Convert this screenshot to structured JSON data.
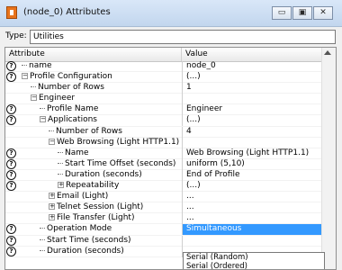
{
  "window": {
    "title": "(node_0) Attributes",
    "buttons": [
      "▭",
      "▣",
      "✕"
    ]
  },
  "type": {
    "label": "Type:",
    "value": "Utilities"
  },
  "headers": {
    "attribute": "Attribute",
    "value": "Value"
  },
  "rows": [
    {
      "q": true,
      "indent": 0,
      "prefix": "dash",
      "label": "name",
      "value": "node_0"
    },
    {
      "q": true,
      "indent": 0,
      "prefix": "minus",
      "label": "Profile Configuration",
      "value": "(...)"
    },
    {
      "q": false,
      "indent": 1,
      "prefix": "dash",
      "label": "Number of Rows",
      "value": "1"
    },
    {
      "q": false,
      "indent": 1,
      "prefix": "minus",
      "label": "Engineer",
      "value": ""
    },
    {
      "q": true,
      "indent": 2,
      "prefix": "dash",
      "label": "Profile Name",
      "value": "Engineer"
    },
    {
      "q": true,
      "indent": 2,
      "prefix": "minus",
      "label": "Applications",
      "value": "(...)"
    },
    {
      "q": false,
      "indent": 3,
      "prefix": "dash",
      "label": "Number of Rows",
      "value": "4"
    },
    {
      "q": false,
      "indent": 3,
      "prefix": "minus",
      "label": "Web Browsing (Light HTTP1.1)",
      "value": ""
    },
    {
      "q": true,
      "indent": 4,
      "prefix": "dash",
      "label": "Name",
      "value": "Web Browsing (Light HTTP1.1)"
    },
    {
      "q": true,
      "indent": 4,
      "prefix": "dash",
      "label": "Start Time Offset (seconds)",
      "value": "uniform (5,10)"
    },
    {
      "q": true,
      "indent": 4,
      "prefix": "dash",
      "label": "Duration (seconds)",
      "value": "End of Profile"
    },
    {
      "q": true,
      "indent": 4,
      "prefix": "plus",
      "label": "Repeatability",
      "value": "(...)"
    },
    {
      "q": false,
      "indent": 3,
      "prefix": "plus",
      "label": "Email (Light)",
      "value": "..."
    },
    {
      "q": false,
      "indent": 3,
      "prefix": "plus",
      "label": "Telnet Session (Light)",
      "value": "..."
    },
    {
      "q": false,
      "indent": 3,
      "prefix": "plus",
      "label": "File Transfer (Light)",
      "value": "..."
    },
    {
      "q": true,
      "indent": 2,
      "prefix": "dash",
      "label": "Operation Mode",
      "value": "Simultaneous",
      "selected": true
    },
    {
      "q": true,
      "indent": 2,
      "prefix": "dash",
      "label": "Start Time (seconds)",
      "value": ""
    },
    {
      "q": true,
      "indent": 2,
      "prefix": "dash",
      "label": "Duration (seconds)",
      "value": ""
    }
  ],
  "dropdown": {
    "options": [
      "Serial (Random)",
      "Serial (Ordered)"
    ]
  }
}
